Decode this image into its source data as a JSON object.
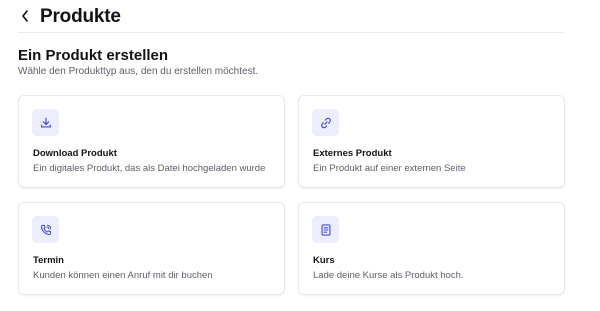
{
  "header": {
    "title": "Produkte",
    "back_icon": "chevron-left-icon"
  },
  "section": {
    "title": "Ein Produkt erstellen",
    "subtitle": "Wähle den Produkttyp aus, den du erstellen möchtest."
  },
  "cards": [
    {
      "icon": "download-icon",
      "title": "Download Produkt",
      "description": "Ein digitales Produkt, das als Datei hochgeladen wurde"
    },
    {
      "icon": "link-icon",
      "title": "Externes Produkt",
      "description": "Ein Produkt auf einer externen Seite"
    },
    {
      "icon": "phone-call-icon",
      "title": "Termin",
      "description": "Kunden können einen Anruf mit dir buchen"
    },
    {
      "icon": "document-icon",
      "title": "Kurs",
      "description": "Lade deine Kurse als Produkt hoch."
    }
  ],
  "colors": {
    "accent": "#4a4fd6",
    "icon_bg": "#eceefe",
    "border": "#e6e7eb"
  }
}
